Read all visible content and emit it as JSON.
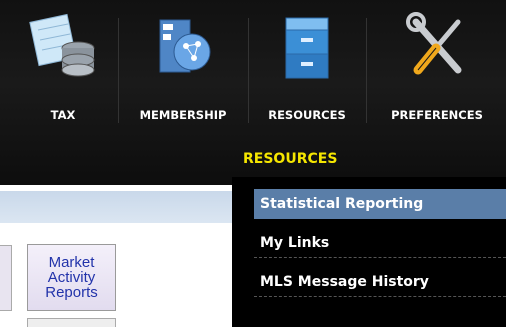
{
  "nav": {
    "items": [
      {
        "label": "TAX",
        "icon": "tax-icon"
      },
      {
        "label": "MEMBERSHIP",
        "icon": "membership-icon"
      },
      {
        "label": "RESOURCES",
        "icon": "resources-icon"
      },
      {
        "label": "PREFERENCES",
        "icon": "preferences-icon"
      }
    ]
  },
  "submenu": {
    "title": "RESOURCES",
    "items": [
      {
        "label": "Statistical Reporting",
        "active": true
      },
      {
        "label": "My Links",
        "active": false
      },
      {
        "label": "MLS Message History",
        "active": false
      }
    ]
  },
  "tile": {
    "label": "Market\nActivity\nReports"
  },
  "colors": {
    "submenu_title": "#f5e600",
    "active_item": "#5a7ea8",
    "tile_text": "#2233aa"
  }
}
